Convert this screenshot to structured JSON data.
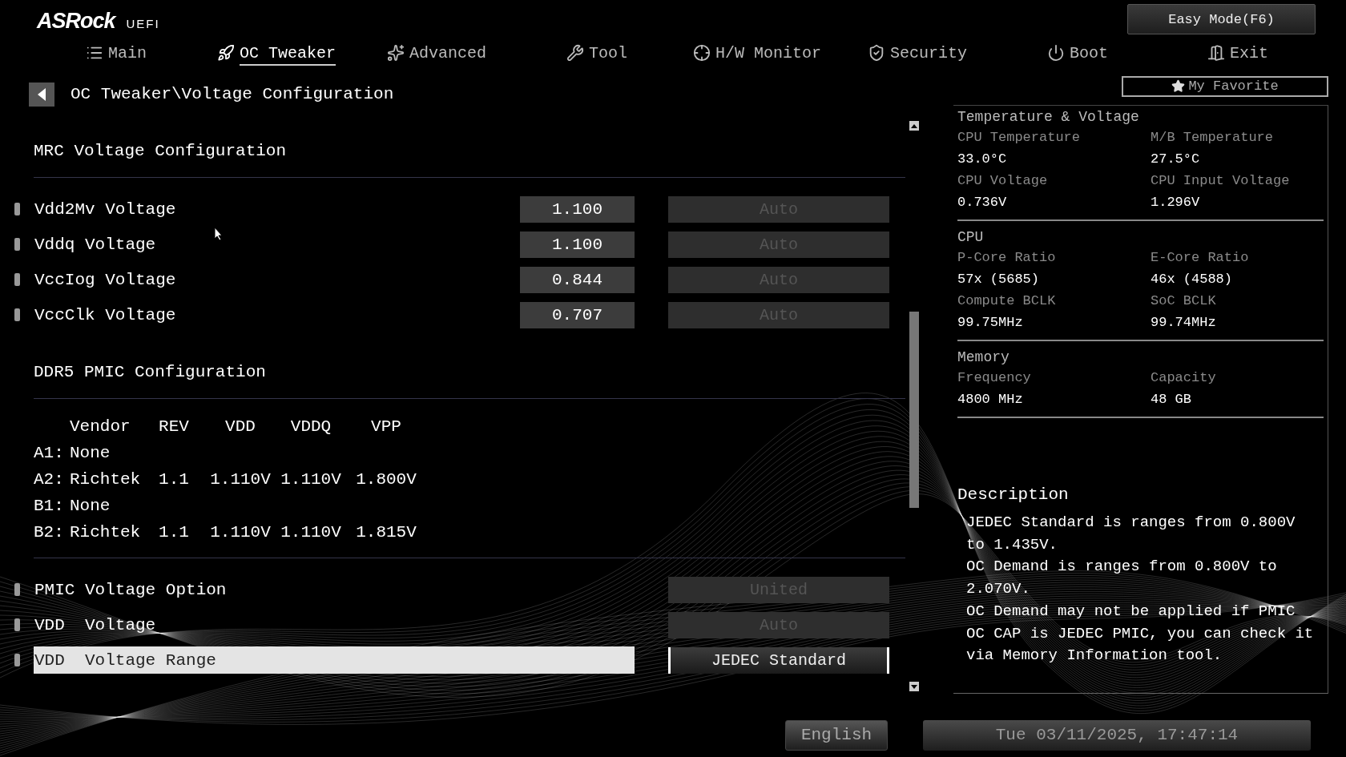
{
  "brand": {
    "logo": "ASRock",
    "suffix": "UEFI"
  },
  "easy_mode": "Easy Mode(F6)",
  "tabs": [
    {
      "label": "Main",
      "selected": false
    },
    {
      "label": "OC Tweaker",
      "selected": true
    },
    {
      "label": "Advanced",
      "selected": false
    },
    {
      "label": "Tool",
      "selected": false
    },
    {
      "label": "H/W Monitor",
      "selected": false
    },
    {
      "label": "Security",
      "selected": false
    },
    {
      "label": "Boot",
      "selected": false
    },
    {
      "label": "Exit",
      "selected": false
    }
  ],
  "breadcrumb": "OC Tweaker\\Voltage Configuration",
  "my_favorite": "My Favorite",
  "items": [
    {
      "kind": "heading",
      "text": "MRC Voltage Configuration"
    },
    {
      "kind": "setting",
      "label": "Vdd2Mv Voltage",
      "value": "1.100",
      "option": "Auto",
      "disabled": true,
      "selected": false
    },
    {
      "kind": "setting",
      "label": "Vddq Voltage",
      "value": "1.100",
      "option": "Auto",
      "disabled": true,
      "selected": false
    },
    {
      "kind": "setting",
      "label": "VccIog Voltage",
      "value": "0.844",
      "option": "Auto",
      "disabled": true,
      "selected": false
    },
    {
      "kind": "setting",
      "label": "VccClk Voltage",
      "value": "0.707",
      "option": "Auto",
      "disabled": true,
      "selected": false
    },
    {
      "kind": "heading",
      "text": "DDR5 PMIC Configuration"
    },
    {
      "kind": "table",
      "columns": [
        "Vendor",
        "REV",
        "VDD",
        "VDDQ",
        "VPP"
      ],
      "rows": [
        {
          "slot": "A1:",
          "cells": [
            "None"
          ]
        },
        {
          "slot": "A2:",
          "cells": [
            "Richtek",
            "1.1",
            "1.110V",
            "1.110V",
            "1.800V"
          ]
        },
        {
          "slot": "B1:",
          "cells": [
            "None"
          ]
        },
        {
          "slot": "B2:",
          "cells": [
            "Richtek",
            "1.1",
            "1.110V",
            "1.110V",
            "1.815V"
          ]
        }
      ]
    },
    {
      "kind": "setting",
      "label": "PMIC Voltage Option",
      "option": "United",
      "disabled": true,
      "selected": false
    },
    {
      "kind": "setting",
      "label": "VDD  Voltage",
      "option": "Auto",
      "disabled": true,
      "selected": false
    },
    {
      "kind": "setting",
      "label": "VDD  Voltage Range",
      "option": "JEDEC Standard",
      "disabled": false,
      "selected": true
    }
  ],
  "info": [
    {
      "title": "Temperature & Voltage",
      "fields": [
        {
          "label": "CPU Temperature",
          "value": "33.0°C"
        },
        {
          "label": "M/B Temperature",
          "value": "27.5°C"
        },
        {
          "label": "CPU Voltage",
          "value": "0.736V"
        },
        {
          "label": "CPU Input Voltage",
          "value": "1.296V"
        }
      ]
    },
    {
      "title": "CPU",
      "fields": [
        {
          "label": "P-Core Ratio",
          "value": "57x (5685)"
        },
        {
          "label": "E-Core Ratio",
          "value": "46x (4588)"
        },
        {
          "label": "Compute BCLK",
          "value": "99.75MHz"
        },
        {
          "label": "SoC BCLK",
          "value": "99.74MHz"
        }
      ]
    },
    {
      "title": "Memory",
      "fields": [
        {
          "label": "Frequency",
          "value": "4800 MHz"
        },
        {
          "label": "Capacity",
          "value": "48 GB"
        }
      ]
    }
  ],
  "description": {
    "title": "Description",
    "lines": [
      "JEDEC Standard is ranges from 0.800V",
      "to 1.435V.",
      "OC Demand is ranges from 0.800V to",
      "2.070V.",
      "OC Demand may not be applied if PMIC",
      "OC CAP is JEDEC PMIC, you can check it",
      "via Memory Information tool."
    ]
  },
  "language": "English",
  "datetime": "Tue 03/11/2025, 17:47:14"
}
